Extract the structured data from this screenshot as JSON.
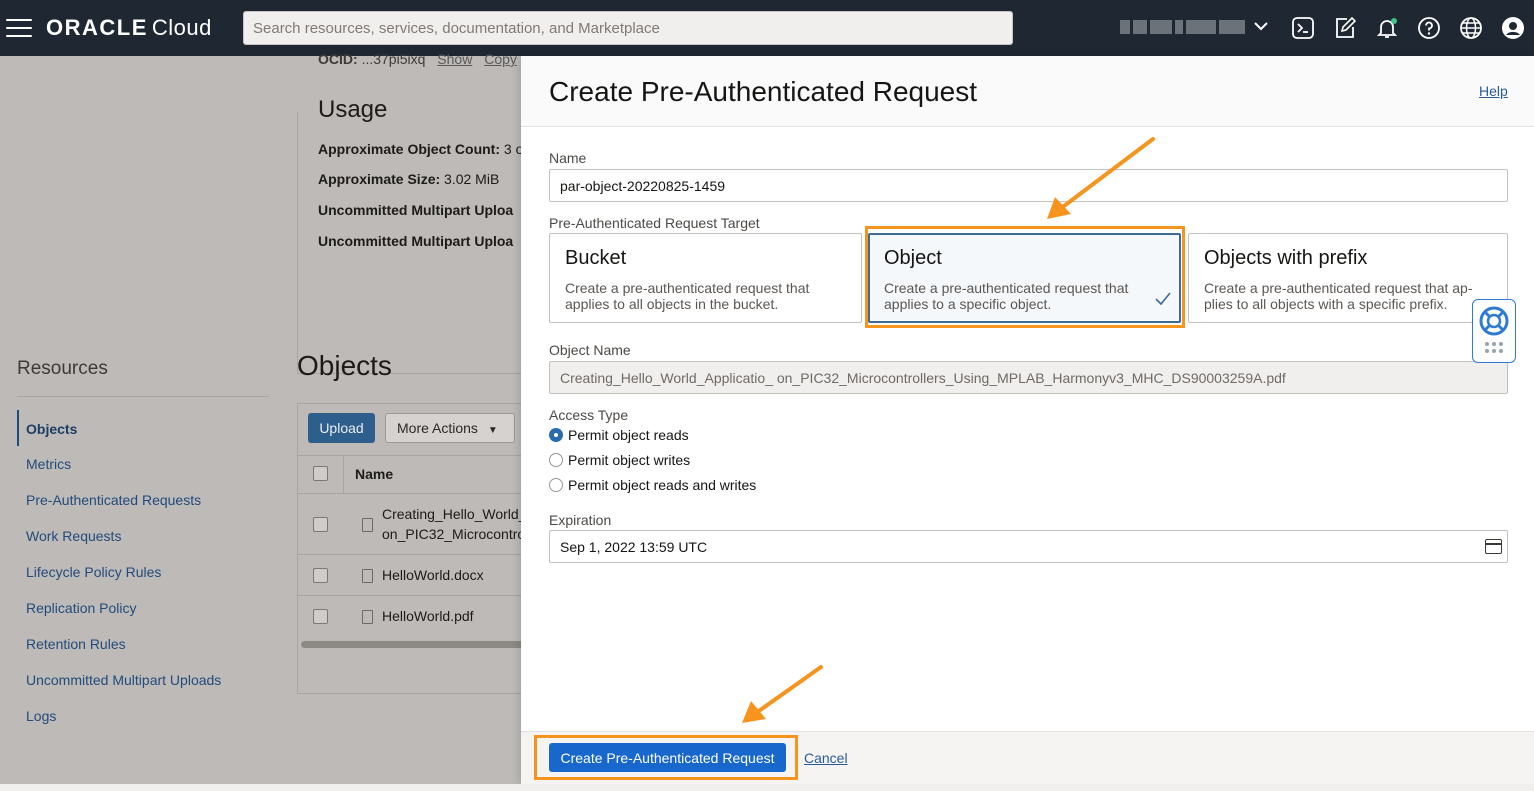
{
  "topbar": {
    "logo_brand": "ORACLE",
    "logo_product": "Cloud",
    "search_placeholder": "Search resources, services, documentation, and Marketplace",
    "icons": [
      "menu-icon",
      "cloud-shell-icon",
      "edit-icon",
      "notifications-icon",
      "help-icon",
      "language-icon",
      "profile-icon"
    ]
  },
  "background": {
    "ocid_label": "OCID:",
    "ocid_value": "...37pi5ixq",
    "ocid_show": "Show",
    "ocid_copy": "Copy",
    "usage_title": "Usage",
    "usage_lines": [
      {
        "label": "Approximate Object Count:",
        "value": "3 o"
      },
      {
        "label": "Approximate Size:",
        "value": "3.02 MiB"
      },
      {
        "label": "Uncommitted Multipart Uploa",
        "value": ""
      },
      {
        "label": "Uncommitted Multipart Uploa",
        "value": ""
      }
    ],
    "resources_title": "Resources",
    "resources_links": [
      "Objects",
      "Metrics",
      "Pre-Authenticated Requests",
      "Work Requests",
      "Lifecycle Policy Rules",
      "Replication Policy",
      "Retention Rules",
      "Uncommitted Multipart Uploads",
      "Logs"
    ],
    "objects_title": "Objects",
    "upload_label": "Upload",
    "more_actions_label": "More Actions",
    "table_header_name": "Name",
    "rows": [
      {
        "line1": "Creating_Hello_World_",
        "line2": "on_PIC32_Microcontro"
      },
      {
        "line1": "HelloWorld.docx",
        "line2": ""
      },
      {
        "line1": "HelloWorld.pdf",
        "line2": ""
      }
    ]
  },
  "drawer": {
    "title": "Create Pre-Authenticated Request",
    "help": "Help",
    "name_label": "Name",
    "name_value": "par-object-20220825-1459",
    "target_label": "Pre-Authenticated Request Target",
    "targets": [
      {
        "title": "Bucket",
        "desc": "Create a pre-authenticated request that applies to all objects in the bucket.",
        "selected": false
      },
      {
        "title": "Object",
        "desc": "Create a pre-authenticated request that applies to a specific object.",
        "selected": true
      },
      {
        "title": "Objects with prefix",
        "desc": "Create a pre-authenticated request that ap-plies to all objects with a specific prefix.",
        "selected": false
      }
    ],
    "object_name_label": "Object Name",
    "object_name_value": "Creating_Hello_World_Applicatio_ on_PIC32_Microcontrollers_Using_MPLAB_Harmonyv3_MHC_DS90003259A.pdf",
    "access_type_label": "Access Type",
    "access_options": [
      {
        "label": "Permit object reads",
        "selected": true
      },
      {
        "label": "Permit object writes",
        "selected": false
      },
      {
        "label": "Permit object reads and writes",
        "selected": false
      }
    ],
    "expiration_label": "Expiration",
    "expiration_value": "Sep 1, 2022 13:59 UTC",
    "create_button": "Create Pre-Authenticated Request",
    "cancel": "Cancel"
  },
  "colors": {
    "topbar": "#1f2733",
    "primary_button": "#1767cc",
    "highlight": "#f7941d",
    "selected_card_border": "#3e6a98"
  }
}
